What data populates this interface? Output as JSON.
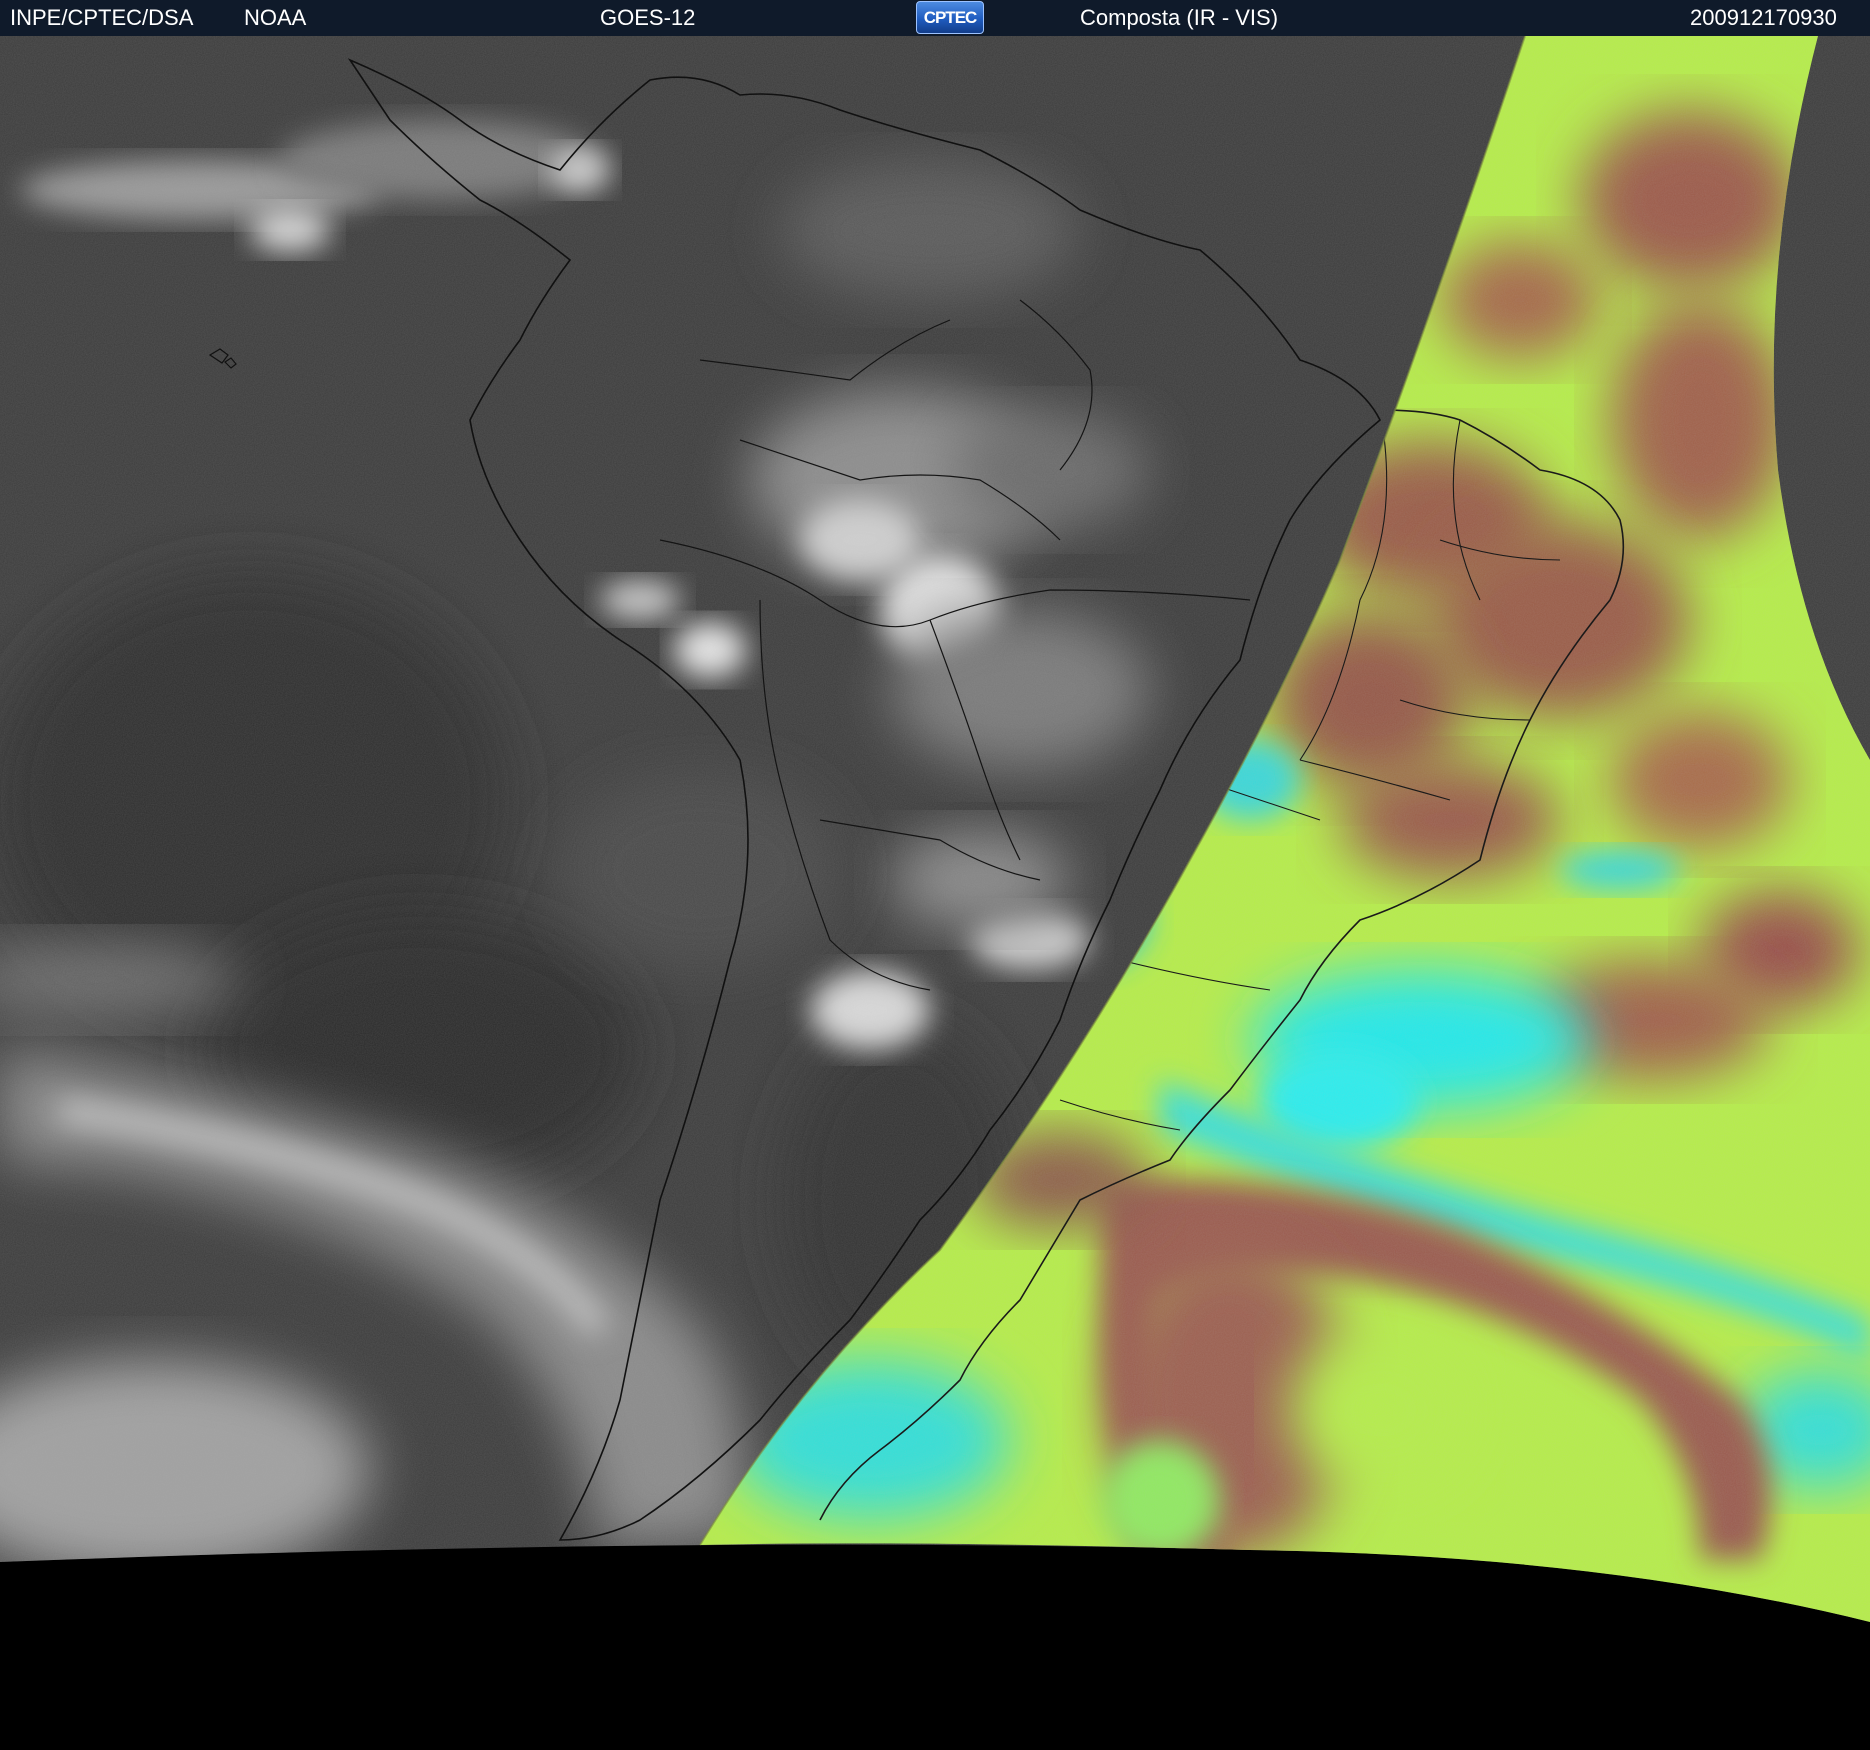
{
  "header": {
    "agency": "INPE/CPTEC/DSA",
    "provider": "NOAA",
    "satellite": "GOES-12",
    "logo_text": "CPTEC",
    "product": "Composta (IR - VIS)",
    "timestamp": "200912170930"
  },
  "colors": {
    "header_bg": "#0f1a2a",
    "ir_gray": "#3e3e3e",
    "vis_green": "#b8f040",
    "vis_brown": "#9a5a48",
    "vis_cyan": "#20e8e8",
    "space": "#000000"
  }
}
